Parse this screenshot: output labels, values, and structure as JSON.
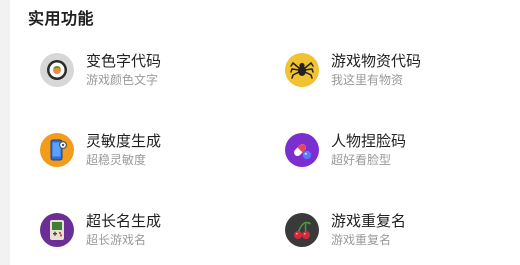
{
  "section": {
    "title": "实用功能"
  },
  "items": [
    {
      "title": "变色字代码",
      "subtitle": "游戏颜色文字",
      "icon": "sushi-icon",
      "color": "#d7d7d7"
    },
    {
      "title": "游戏物资代码",
      "subtitle": "我这里有物资",
      "icon": "spider-icon",
      "color": "#f1c232"
    },
    {
      "title": "灵敏度生成",
      "subtitle": "超稳灵敏度",
      "icon": "phone-settings-icon",
      "color": "#f29b1c"
    },
    {
      "title": "人物捏脸码",
      "subtitle": "超好看脸型",
      "icon": "pills-icon",
      "color": "#7b2fd1"
    },
    {
      "title": "超长名生成",
      "subtitle": "超长游戏名",
      "icon": "gameboy-icon",
      "color": "#6b2e96"
    },
    {
      "title": "游戏重复名",
      "subtitle": "游戏重复名",
      "icon": "cherries-icon",
      "color": "#3a3a3a"
    }
  ]
}
